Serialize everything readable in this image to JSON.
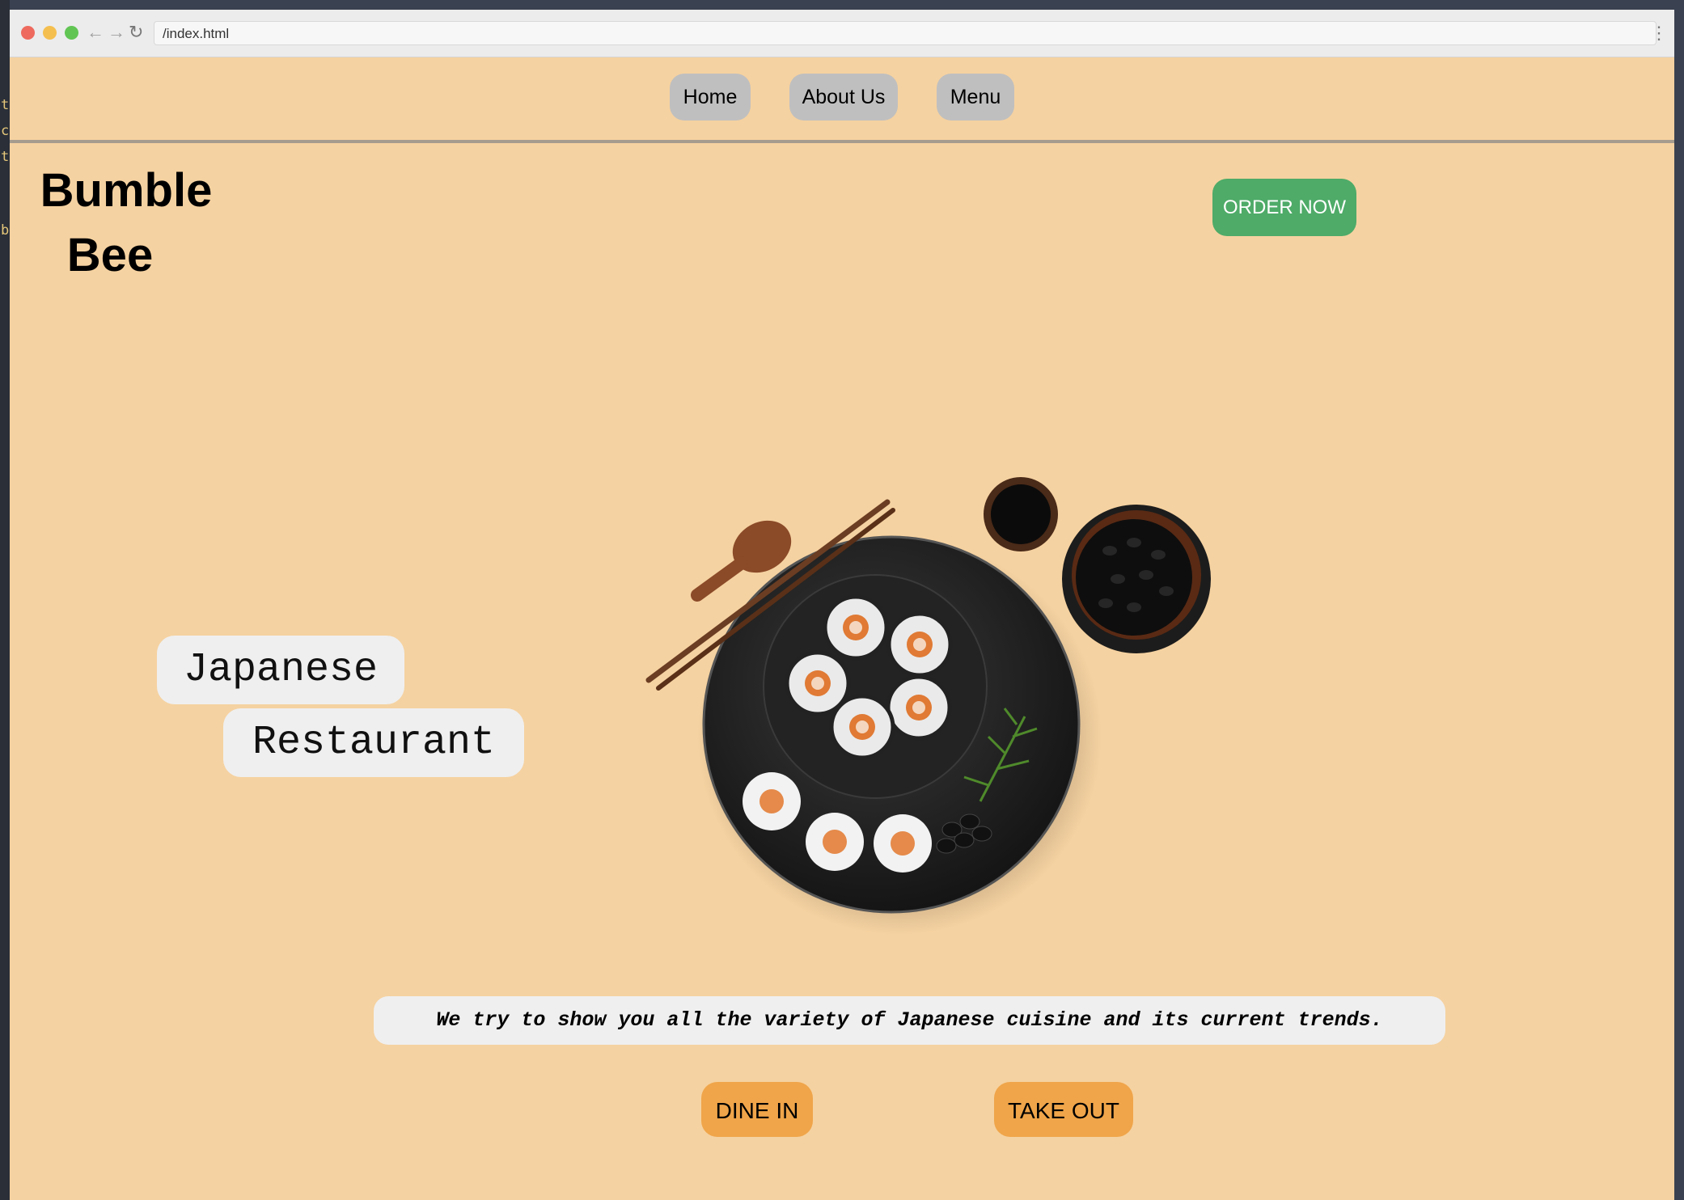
{
  "browser": {
    "address": "/index.html"
  },
  "nav": {
    "items": [
      {
        "label": "Home"
      },
      {
        "label": "About Us"
      },
      {
        "label": "Menu"
      }
    ]
  },
  "hero": {
    "brand_line1": "Bumble",
    "brand_line2": "Bee",
    "order_button": "ORDER NOW",
    "subtitle_line1": "Japanese",
    "subtitle_line2": "Restaurant",
    "tagline": "We try to show you all the variety of Japanese cuisine and its current trends.",
    "dine_in_button": "DINE IN",
    "take_out_button": "TAKE OUT"
  },
  "editor_glyphs": [
    "t",
    "c",
    "t",
    "b"
  ],
  "colors": {
    "page_background": "#f5d2a1",
    "nav_button": "#bfbfbf",
    "order_button": "#4eab68",
    "action_button": "#f0a54a",
    "pill_background": "#efefef"
  }
}
